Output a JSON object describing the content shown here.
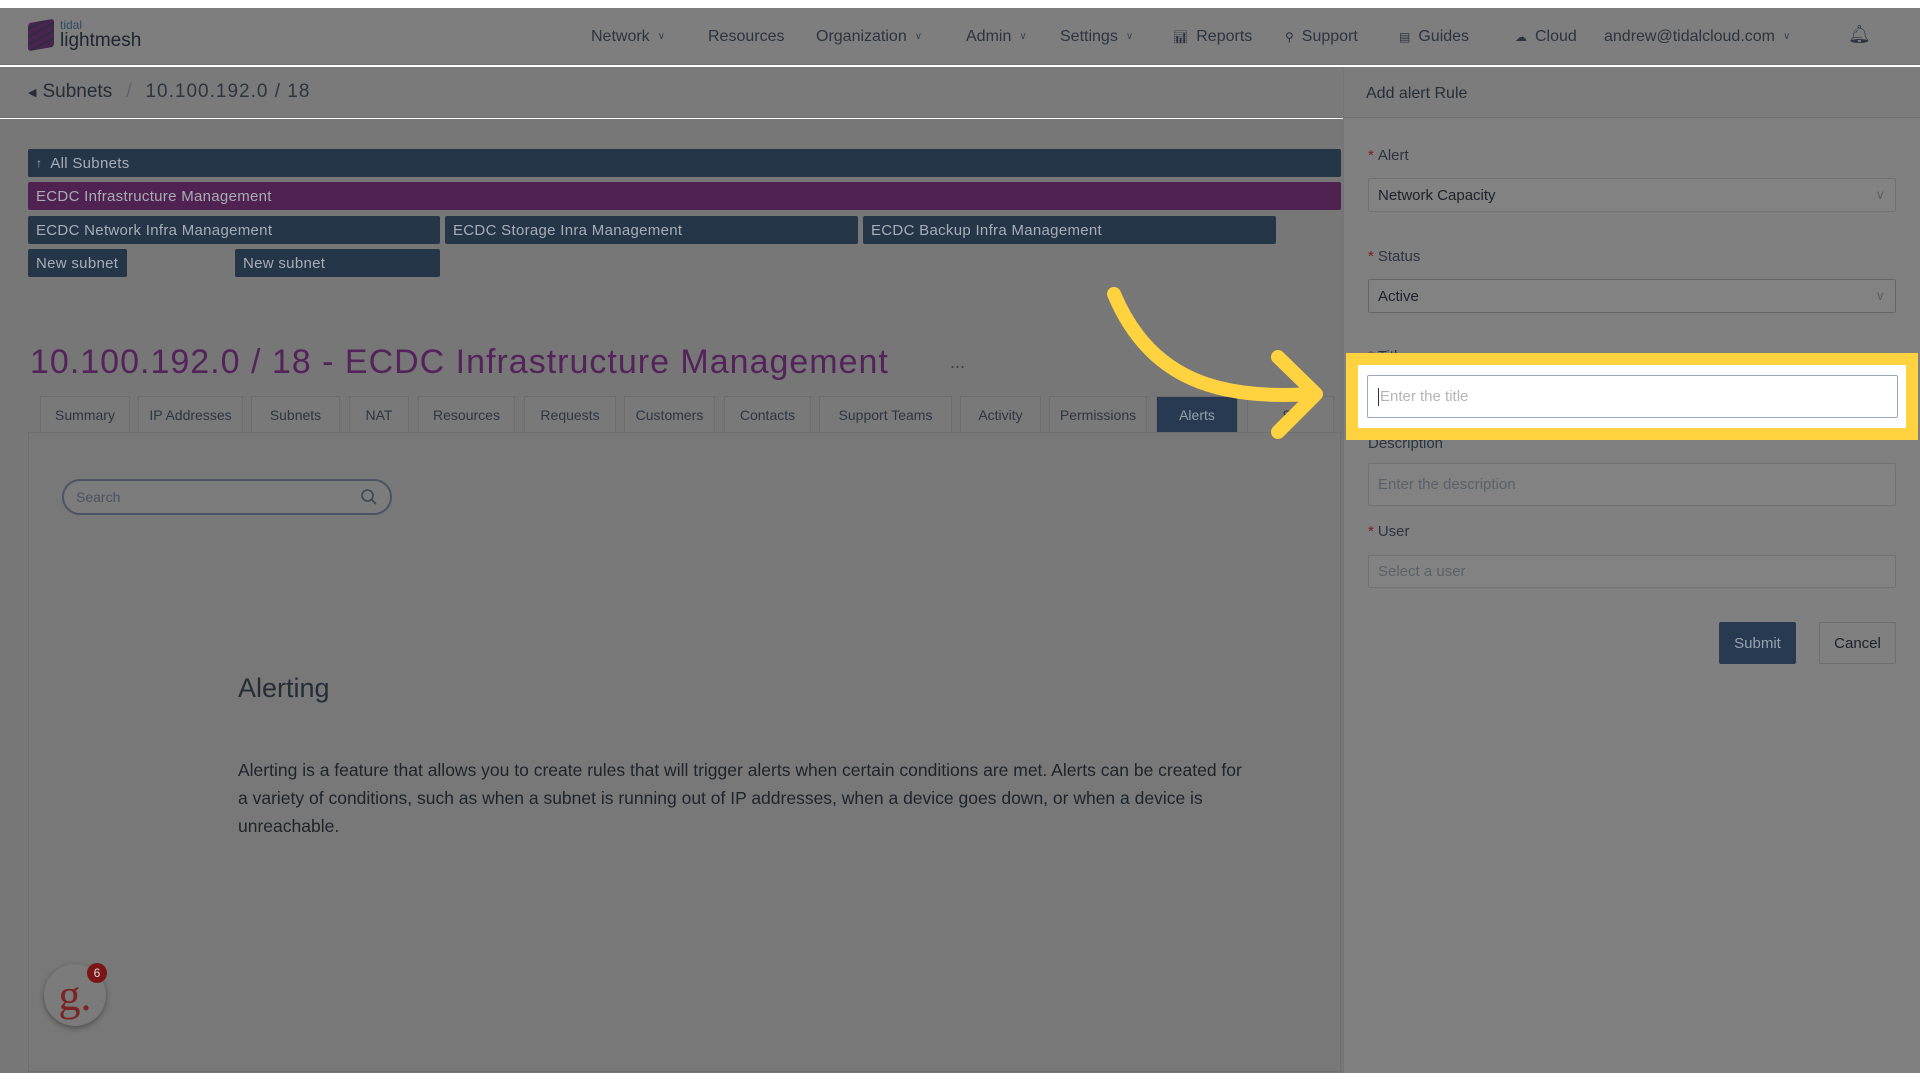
{
  "brand": {
    "small": "tidal",
    "name": "lightmesh"
  },
  "nav": [
    {
      "label": "Network",
      "chev": true
    },
    {
      "label": "Resources"
    },
    {
      "label": "Organization",
      "chev": true
    },
    {
      "label": "Admin",
      "chev": true
    },
    {
      "label": "Settings",
      "chev": true
    },
    {
      "label": "Reports",
      "icon": "chart-icon"
    },
    {
      "label": "Support",
      "icon": "wrench-icon"
    },
    {
      "label": "Guides",
      "icon": "book-icon"
    },
    {
      "label": "Cloud",
      "icon": "cloud-icon"
    },
    {
      "label": "andrew@tidalcloud.com",
      "chev": true
    }
  ],
  "breadcrumb": {
    "back": "Subnets",
    "sep": "/",
    "current": "10.100.192.0 / 18"
  },
  "subnets": {
    "all": "All Subnets",
    "current": "ECDC Infrastructure Management",
    "children": [
      "ECDC Network Infra Management",
      "ECDC Storage Inra Management",
      "ECDC Backup Infra Management"
    ],
    "new": [
      "New subnet",
      "New subnet"
    ]
  },
  "page_title": "10.100.192.0 / 18 - ECDC Infrastructure Management",
  "more": "...",
  "tabs": [
    "Summary",
    "IP Addresses",
    "Subnets",
    "NAT",
    "Resources",
    "Requests",
    "Customers",
    "Contacts",
    "Support Teams",
    "Activity",
    "Permissions",
    "Alerts",
    "Sc"
  ],
  "active_tab": "Alerts",
  "search": {
    "placeholder": "Search"
  },
  "alerting": {
    "heading": "Alerting",
    "body": "Alerting is a feature that allows you to create rules that will trigger alerts when certain conditions are met. Alerts can be created for a variety of conditions, such as when a subnet is running out of IP addresses, when a device goes down, or when a device is unreachable."
  },
  "panel": {
    "title": "Add alert Rule",
    "req": "*",
    "alert": {
      "label": "Alert",
      "value": "Network Capacity"
    },
    "status": {
      "label": "Status",
      "value": "Active"
    },
    "title_field": {
      "label": "Title",
      "placeholder": "Enter the title"
    },
    "description": {
      "label": "Description",
      "placeholder": "Enter the description"
    },
    "user": {
      "label": "User",
      "placeholder": "Select a user"
    },
    "submit": "Submit",
    "cancel": "Cancel"
  },
  "badge": {
    "letter": "g.",
    "count": "6"
  },
  "colors": {
    "highlight": "#ffd23f",
    "navy": "#253649",
    "purple": "#4f2252"
  }
}
